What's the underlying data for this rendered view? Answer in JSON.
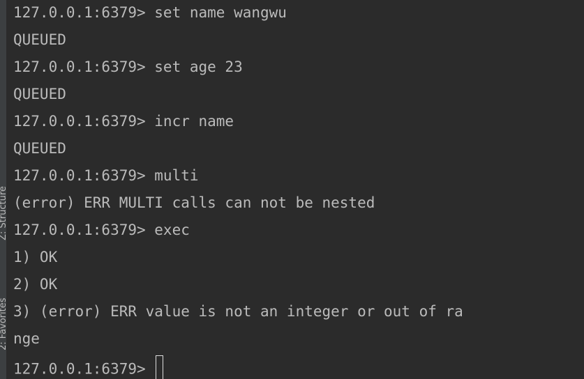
{
  "sidebar": {
    "structure_label": "Z: Structure",
    "favorites_label": "2: Favorites"
  },
  "terminal": {
    "lines": [
      "127.0.0.1:6379> set name wangwu",
      "QUEUED",
      "127.0.0.1:6379> set age 23",
      "QUEUED",
      "127.0.0.1:6379> incr name",
      "QUEUED",
      "127.0.0.1:6379> multi",
      "(error) ERR MULTI calls can not be nested",
      "127.0.0.1:6379> exec",
      "1) OK",
      "2) OK",
      "3) (error) ERR value is not an integer or out of ra",
      "nge"
    ],
    "prompt": "127.0.0.1:6379> "
  }
}
